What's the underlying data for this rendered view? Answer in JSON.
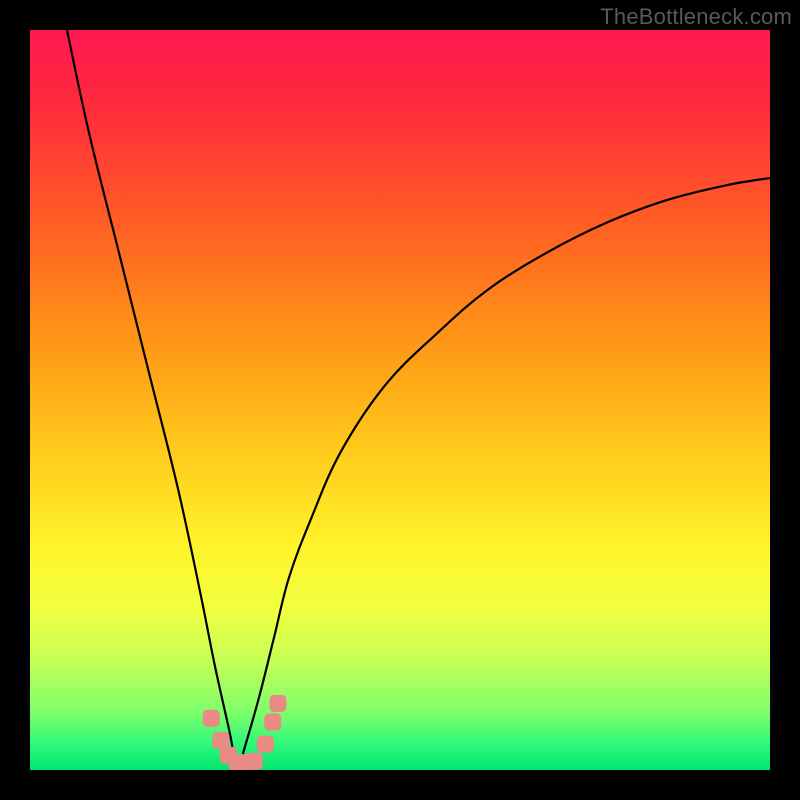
{
  "watermark": "TheBottleneck.com",
  "colors": {
    "frame": "#000000",
    "gradient_stops": [
      {
        "offset": 0.0,
        "color": "#ff1850"
      },
      {
        "offset": 0.1,
        "color": "#ff2a3d"
      },
      {
        "offset": 0.25,
        "color": "#ff5a26"
      },
      {
        "offset": 0.4,
        "color": "#ff8f18"
      },
      {
        "offset": 0.55,
        "color": "#ffc41a"
      },
      {
        "offset": 0.7,
        "color": "#fff42a"
      },
      {
        "offset": 0.78,
        "color": "#f2ff40"
      },
      {
        "offset": 0.85,
        "color": "#c8ff55"
      },
      {
        "offset": 0.92,
        "color": "#80ff6a"
      },
      {
        "offset": 0.965,
        "color": "#30f87a"
      },
      {
        "offset": 1.0,
        "color": "#00e66e"
      }
    ],
    "curve": "#000000",
    "marker_fill": "#e98b84",
    "marker_stroke": "#e98b84"
  },
  "chart_data": {
    "type": "line",
    "title": "",
    "xlabel": "",
    "ylabel": "",
    "x_range": [
      0,
      100
    ],
    "y_range": [
      0,
      100
    ],
    "optimum_x": 28,
    "series": [
      {
        "name": "bottleneck-curve",
        "x": [
          5,
          8,
          12,
          16,
          20,
          23,
          25,
          27,
          28,
          29,
          31,
          33,
          35,
          38,
          42,
          48,
          55,
          62,
          70,
          78,
          86,
          94,
          100
        ],
        "y": [
          100,
          86,
          70,
          54,
          38,
          24,
          14,
          5,
          0,
          3,
          10,
          18,
          26,
          34,
          43,
          52,
          59,
          65,
          70,
          74,
          77,
          79,
          80
        ]
      }
    ],
    "markers": [
      {
        "x": 24.5,
        "y": 7.0
      },
      {
        "x": 25.8,
        "y": 4.0
      },
      {
        "x": 26.8,
        "y": 2.0
      },
      {
        "x": 28.0,
        "y": 1.0
      },
      {
        "x": 29.2,
        "y": 1.0
      },
      {
        "x": 30.3,
        "y": 1.2
      },
      {
        "x": 31.8,
        "y": 3.5
      },
      {
        "x": 32.8,
        "y": 6.5
      },
      {
        "x": 33.5,
        "y": 9.0
      }
    ]
  }
}
